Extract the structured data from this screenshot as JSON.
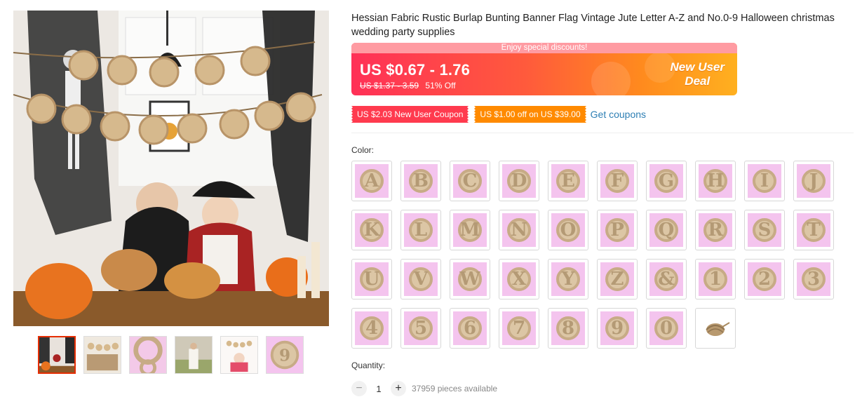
{
  "product": {
    "title": "Hessian Fabric Rustic Burlap Bunting Banner Flag Vintage Jute Letter A-Z and No.0-9 Halloween christmas wedding party supplies"
  },
  "gallery": {
    "thumbnails": [
      "thumb-1",
      "thumb-2",
      "thumb-3",
      "thumb-4",
      "thumb-5",
      "thumb-6"
    ]
  },
  "price": {
    "discount_strip": "Enjoy special discounts!",
    "current": "US $0.67 - 1.76",
    "original": "US $1.37 - 3.59",
    "off": "51% Off",
    "deal_line1": "New User",
    "deal_line2": "Deal"
  },
  "coupons": {
    "new_user": "US $2.03 New User Coupon",
    "store": "US $1.00 off on US $39.00",
    "get": "Get coupons"
  },
  "color": {
    "label": "Color:",
    "options": [
      "A",
      "B",
      "C",
      "D",
      "E",
      "F",
      "G",
      "H",
      "I",
      "J",
      "K",
      "L",
      "M",
      "N",
      "O",
      "P",
      "Q",
      "R",
      "S",
      "T",
      "U",
      "V",
      "W",
      "X",
      "Y",
      "Z",
      "&",
      "1",
      "2",
      "3",
      "4",
      "5",
      "6",
      "7",
      "8",
      "9",
      "0",
      "rope"
    ]
  },
  "quantity": {
    "label": "Quantity:",
    "minus": "−",
    "value": "1",
    "plus": "+",
    "available": "37959 pieces available"
  },
  "colors": {
    "accent_red": "#ff3a4e",
    "accent_orange": "#ff8a00",
    "link": "#2e7fb4",
    "swatch_pink": "#f4c4ee",
    "jute": "#c7ab86"
  }
}
